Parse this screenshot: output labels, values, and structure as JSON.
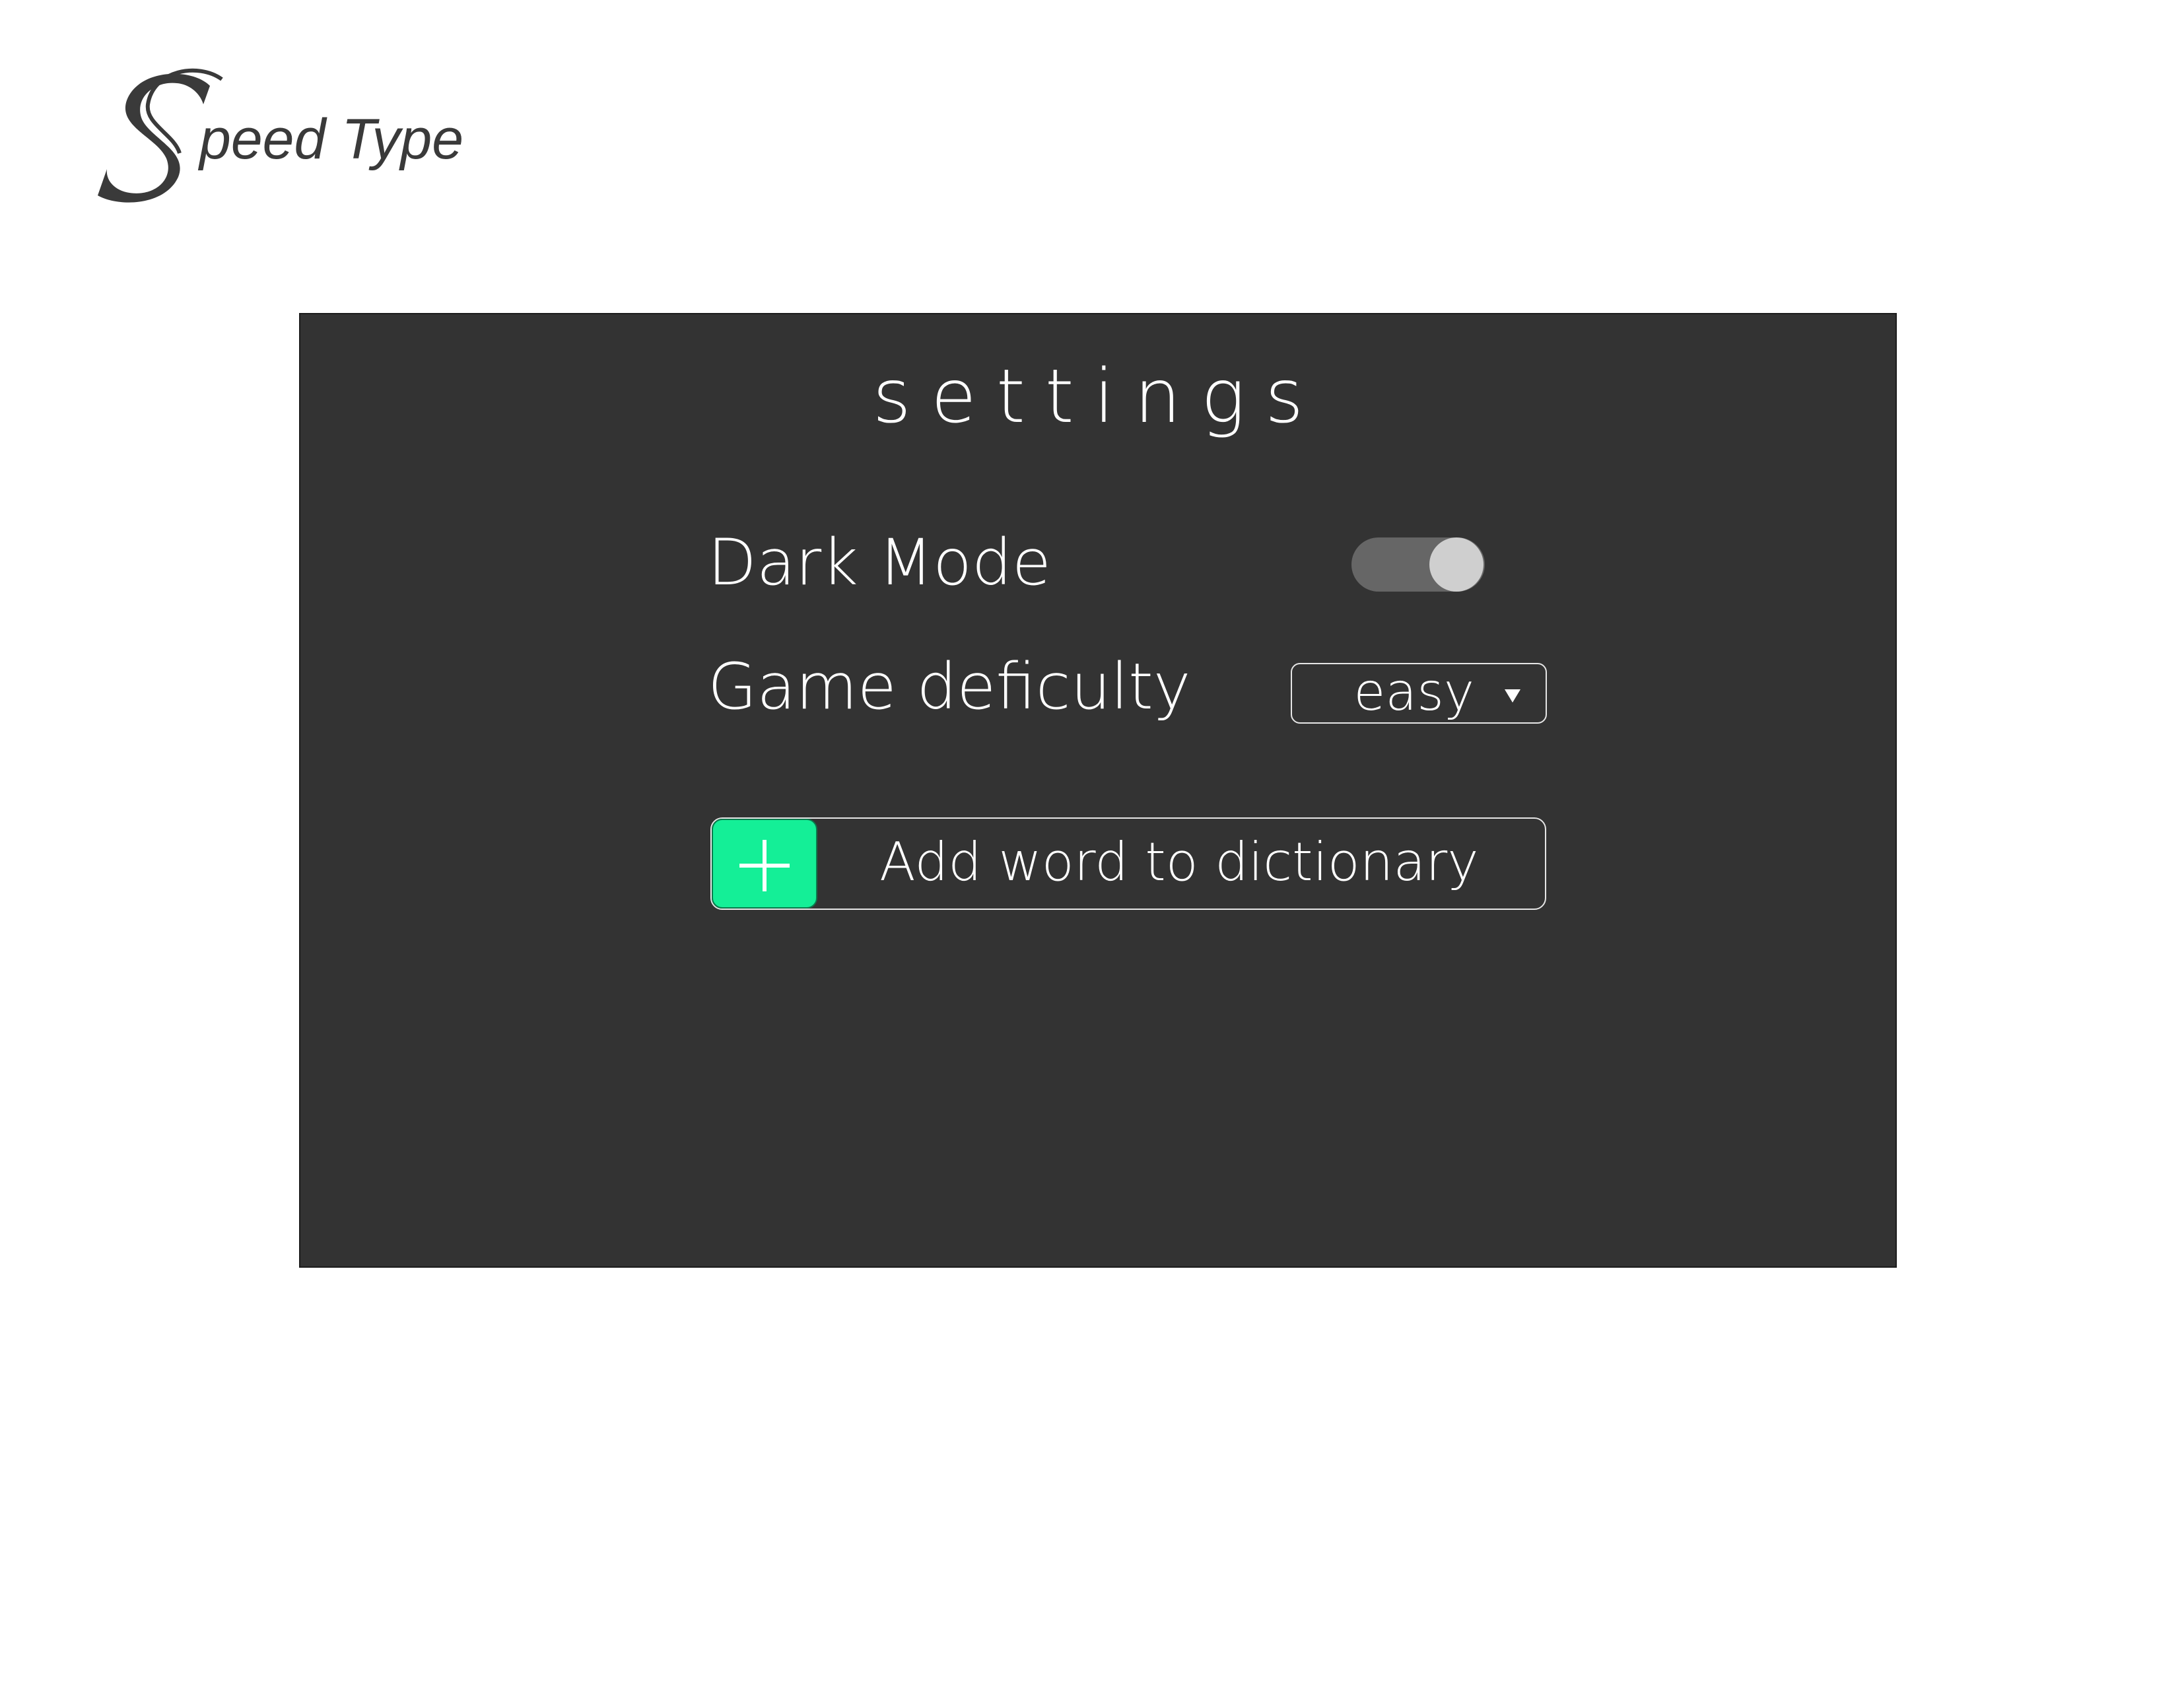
{
  "app": {
    "logo_text": "Speed Type",
    "logo_suffix": "peed Type"
  },
  "settings": {
    "title": "settings",
    "dark_mode": {
      "label": "Dark Mode",
      "enabled": true
    },
    "difficulty": {
      "label": "Game deficulty",
      "selected": "easy"
    },
    "add_word": {
      "label": "Add word to dictionary",
      "icon": "plus-icon"
    }
  },
  "colors": {
    "panel_bg": "#333333",
    "accent": "#14ef97",
    "toggle_track": "#666666",
    "toggle_knob": "#cfcfcf",
    "text": "#ffffff",
    "logo": "#3a3a3a"
  }
}
